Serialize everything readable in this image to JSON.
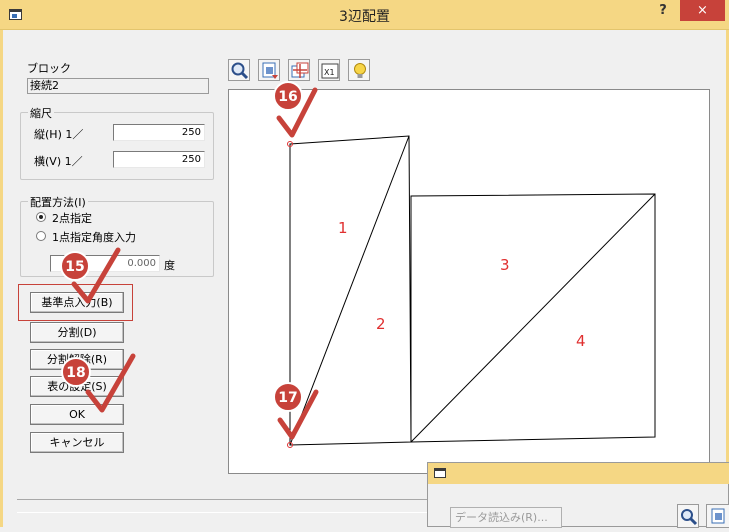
{
  "window": {
    "title": "3辺配置",
    "help_label": "?",
    "close_label": "×"
  },
  "block": {
    "label": "ブロック",
    "value": "接続2"
  },
  "scale": {
    "group_label": "縮尺",
    "vertical_label": "縦(H) 1／",
    "vertical_value": "250",
    "horizontal_label": "横(V) 1／",
    "horizontal_value": "250"
  },
  "placement": {
    "group_label": "配置方法(I)",
    "option_2point": "2点指定",
    "option_1point_angle": "1点指定角度入力",
    "angle_value": "0.000",
    "angle_unit": "度",
    "selected_option": "2点指定"
  },
  "buttons": {
    "base_point": "基準点入力(B)",
    "split": "分割(D)",
    "split_release": "分割解除(R)",
    "table_settings": "表の設定(S)",
    "ok": "OK",
    "cancel": "キャンセル"
  },
  "toolbar": [
    "zoom-icon",
    "zoom-all-icon",
    "center-icon",
    "zoom-fit-icon",
    "hint-bulb-icon"
  ],
  "drawing": {
    "region_labels": [
      "1",
      "2",
      "3",
      "4"
    ]
  },
  "callouts": [
    "16",
    "15",
    "18",
    "17"
  ],
  "sub_window": {
    "data_read_label": "データ読込み(R)..."
  },
  "colors": {
    "title_bar": "#f5d784",
    "close_button": "#c7423a",
    "callout_circle": "#c7423a",
    "region_label": "#e03030"
  }
}
